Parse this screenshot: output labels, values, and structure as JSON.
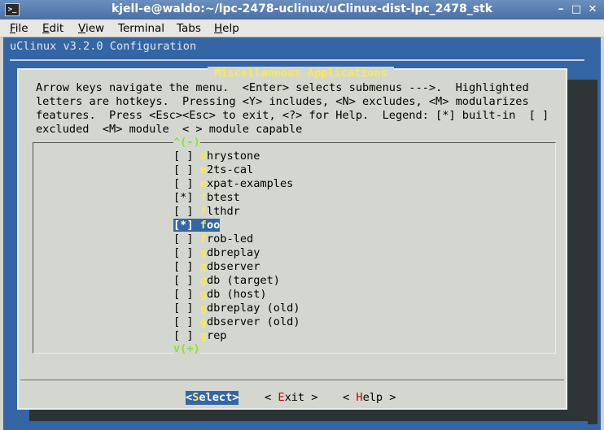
{
  "window": {
    "title": "kjell-e@waldo:~/lpc-2478-uclinux/uClinux-dist-lpc_2478_stk",
    "icon": ">_",
    "min_glyph": "–",
    "max_glyph": "□",
    "close_glyph": "✕"
  },
  "menubar": {
    "items": [
      {
        "hot": "F",
        "rest": "ile"
      },
      {
        "hot": "E",
        "rest": "dit"
      },
      {
        "hot": "V",
        "rest": "iew"
      },
      {
        "hot": "",
        "rest": "Terminal"
      },
      {
        "hot": "",
        "rest": "Tabs"
      },
      {
        "hot": "H",
        "rest": "elp"
      }
    ]
  },
  "config": {
    "header": "uClinux v3.2.0 Configuration",
    "dialog_title": " Miscellaneous Applications ",
    "help_lines": [
      "Arrow keys navigate the menu.  <Enter> selects submenus --->.  Highlighted",
      "letters are hotkeys.  Pressing <Y> includes, <N> excludes, <M> modularizes",
      "features.  Press <Esc><Esc> to exit, <?> for Help.  Legend: [*] built-in  [ ]",
      "excluded  <M> module  < > module capable"
    ],
    "scroll_up": "^(-)",
    "scroll_down": "v(+)",
    "items": [
      {
        "box": "[ ]",
        "hot": "d",
        "rest": "hrystone"
      },
      {
        "box": "[ ]",
        "hot": "e",
        "rest": "2ts-cal"
      },
      {
        "box": "[ ]",
        "hot": "e",
        "rest": "xpat-examples"
      },
      {
        "box": "[*]",
        "hot": "f",
        "rest": "btest"
      },
      {
        "box": "[ ]",
        "hot": "f",
        "rest": "lthdr"
      },
      {
        "box": "[*]",
        "hot": "f",
        "rest": "oo"
      },
      {
        "box": "[ ]",
        "hot": "f",
        "rest": "rob-led"
      },
      {
        "box": "[ ]",
        "hot": "g",
        "rest": "dbreplay"
      },
      {
        "box": "[ ]",
        "hot": "g",
        "rest": "dbserver"
      },
      {
        "box": "[ ]",
        "hot": "g",
        "rest": "db (target)"
      },
      {
        "box": "[ ]",
        "hot": "g",
        "rest": "db (host)"
      },
      {
        "box": "[ ]",
        "hot": "g",
        "rest": "dbreplay (old)"
      },
      {
        "box": "[ ]",
        "hot": "g",
        "rest": "dbserver (old)"
      },
      {
        "box": "[ ]",
        "hot": "g",
        "rest": "rep"
      }
    ],
    "selected_index": 5,
    "buttons": {
      "select": {
        "pre": "<",
        "hot": "S",
        "rest": "elect>"
      },
      "exit": {
        "pre": "< ",
        "hot": "E",
        "rest": "xit >"
      },
      "help": {
        "pre": "< ",
        "hot": "H",
        "rest": "elp >"
      }
    }
  },
  "colors": {
    "terminal_bg": "#3465a4",
    "dialog_bg": "#d3d7cf",
    "hotkey": "#fce94f",
    "button_hotkey": "#cc0000"
  }
}
